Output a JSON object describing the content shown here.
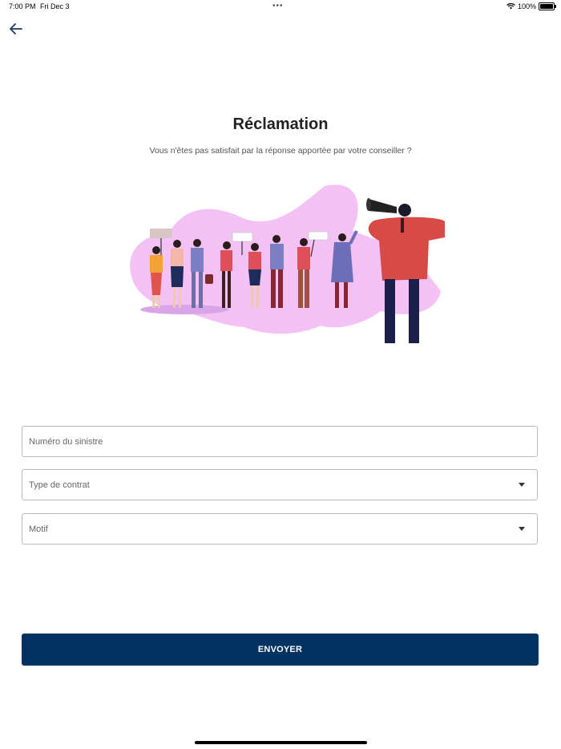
{
  "status_bar": {
    "time": "7:00 PM",
    "date": "Fri Dec 3",
    "dots": "•••",
    "battery": "100%",
    "wifi_icon": "wifi-icon",
    "battery_icon": "battery-icon"
  },
  "nav": {
    "back_icon": "arrow-left-icon"
  },
  "page": {
    "title": "Réclamation",
    "subtitle": "Vous n'êtes pas satisfait par la réponse apportée par votre conseiller ?"
  },
  "form": {
    "claim_number_placeholder": "Numéro du sinistre",
    "contract_type_label": "Type de contrat",
    "reason_label": "Motif",
    "submit_label": "ENVOYER"
  },
  "colors": {
    "primary": "#003361",
    "blob": "#f3c1f3",
    "megaphone_man": "#d84a46"
  }
}
